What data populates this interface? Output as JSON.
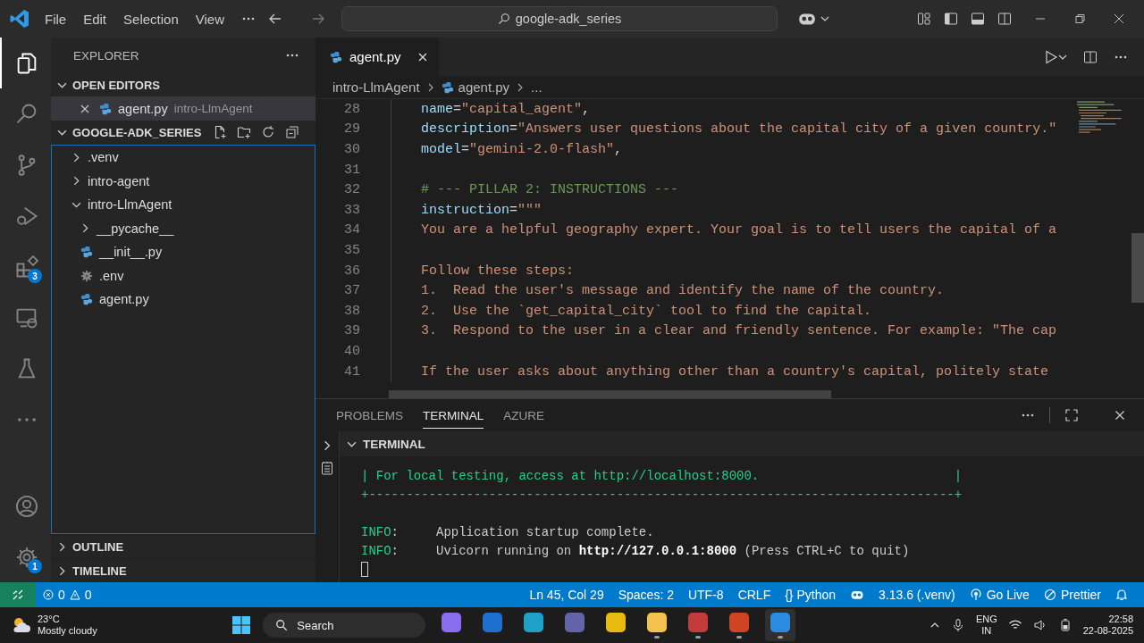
{
  "title_bar": {
    "menu": [
      "File",
      "Edit",
      "Selection",
      "View"
    ],
    "search": "google-adk_series"
  },
  "activity_bar": {
    "top": [
      {
        "kind": "explorer",
        "selected": true
      },
      {
        "kind": "search",
        "selected": false
      },
      {
        "kind": "source-control",
        "selected": false
      },
      {
        "kind": "run-debug",
        "selected": false
      },
      {
        "kind": "extensions",
        "selected": false,
        "badge": "3"
      },
      {
        "kind": "remote",
        "selected": false
      },
      {
        "kind": "testing",
        "selected": false
      },
      {
        "kind": "more",
        "selected": false
      }
    ],
    "bottom": [
      {
        "kind": "accounts",
        "selected": false
      },
      {
        "kind": "manage",
        "selected": false,
        "badge": "1"
      }
    ]
  },
  "sidebar": {
    "title": "EXPLORER",
    "open_editors": {
      "title": "OPEN EDITORS",
      "expanded": true,
      "items": [
        {
          "name": "agent.py",
          "folder": "intro-LlmAgent",
          "kind": "python"
        }
      ]
    },
    "workspace": {
      "title": "GOOGLE-ADK_SERIES",
      "expanded": true,
      "tree": [
        {
          "name": ".venv",
          "kind": "folder",
          "expanded": false
        },
        {
          "name": "intro-agent",
          "kind": "folder",
          "expanded": false
        },
        {
          "name": "intro-LlmAgent",
          "kind": "folder",
          "expanded": true,
          "children": [
            {
              "name": "__pycache__",
              "kind": "folder",
              "expanded": false
            },
            {
              "name": "__init__.py",
              "kind": "python"
            },
            {
              "name": ".env",
              "kind": "settings"
            },
            {
              "name": "agent.py",
              "kind": "python"
            }
          ]
        }
      ]
    },
    "sections": [
      {
        "title": "OUTLINE",
        "expanded": false
      },
      {
        "title": "TIMELINE",
        "expanded": false
      }
    ]
  },
  "editor": {
    "tabs": [
      {
        "label": "agent.py",
        "kind": "python",
        "selected": true
      }
    ],
    "breadcrumb": [
      {
        "text": "intro-LlmAgent",
        "kind": "folder"
      },
      {
        "text": "agent.py",
        "kind": "python"
      },
      {
        "text": "...",
        "kind": "more"
      }
    ],
    "lines": [
      {
        "number": "28",
        "tokens": [
          {
            "kind": "key",
            "text": "name"
          },
          {
            "kind": "plain",
            "text": "="
          },
          {
            "kind": "string",
            "text": "\"capital_agent\""
          },
          {
            "kind": "plain",
            "text": ","
          }
        ]
      },
      {
        "number": "29",
        "tokens": [
          {
            "kind": "key",
            "text": "description"
          },
          {
            "kind": "plain",
            "text": "="
          },
          {
            "kind": "string",
            "text": "\"Answers user questions about the capital city of a given country.\""
          }
        ]
      },
      {
        "number": "30",
        "tokens": [
          {
            "kind": "key",
            "text": "model"
          },
          {
            "kind": "plain",
            "text": "="
          },
          {
            "kind": "string",
            "text": "\"gemini-2.0-flash\""
          },
          {
            "kind": "plain",
            "text": ","
          }
        ]
      },
      {
        "number": "31"
      },
      {
        "number": "32",
        "tokens": [
          {
            "kind": "comment",
            "text": "# --- PILLAR 2: INSTRUCTIONS ---"
          }
        ]
      },
      {
        "number": "33",
        "tokens": [
          {
            "kind": "key",
            "text": "instruction"
          },
          {
            "kind": "plain",
            "text": "="
          },
          {
            "kind": "string",
            "text": "\"\"\""
          }
        ]
      },
      {
        "number": "34",
        "tokens": [
          {
            "kind": "string",
            "text": "You are a helpful geography expert. Your goal is to tell users the capital of a"
          }
        ]
      },
      {
        "number": "35"
      },
      {
        "number": "36",
        "tokens": [
          {
            "kind": "string",
            "text": "Follow these steps:"
          }
        ]
      },
      {
        "number": "37",
        "tokens": [
          {
            "kind": "string",
            "text": "1.  Read the user's message and identify the name of the country."
          }
        ]
      },
      {
        "number": "38",
        "tokens": [
          {
            "kind": "string",
            "text": "2.  Use the `get_capital_city` tool to find the capital."
          }
        ]
      },
      {
        "number": "39",
        "tokens": [
          {
            "kind": "string",
            "text": "3.  Respond to the user in a clear and friendly sentence. For example: \"The cap"
          }
        ]
      },
      {
        "number": "40"
      },
      {
        "number": "41",
        "tokens": [
          {
            "kind": "string",
            "text": "If the user asks about anything other than a country's capital, politely state"
          }
        ]
      }
    ]
  },
  "panel": {
    "tabs": [
      {
        "label": "PROBLEMS",
        "selected": false
      },
      {
        "label": "TERMINAL",
        "selected": true
      },
      {
        "label": "AZURE",
        "selected": false
      }
    ],
    "section": {
      "title": "TERMINAL",
      "expanded": true
    },
    "lines": [
      {
        "tokens": [
          {
            "kind": "green",
            "text": "| For local testing, access at http://localhost:8000.                          |"
          }
        ]
      },
      {
        "tokens": [
          {
            "kind": "green",
            "text": "+------------------------------------------------------------------------------+"
          }
        ]
      },
      {
        "gap_before": true,
        "tokens": [
          {
            "kind": "green",
            "text": "INFO"
          },
          {
            "kind": "plain",
            "text": ":     Application startup complete."
          }
        ]
      },
      {
        "tokens": [
          {
            "kind": "green",
            "text": "INFO"
          },
          {
            "kind": "plain",
            "text": ":     Uvicorn running on "
          },
          {
            "kind": "bold",
            "text": "http://127.0.0.1:8000"
          },
          {
            "kind": "plain",
            "text": " (Press CTRL+C to quit)"
          }
        ]
      }
    ]
  },
  "status_bar": {
    "errors": "0",
    "warnings": "0",
    "items": [
      {
        "kind": "text",
        "text": "Ln 45, Col 29"
      },
      {
        "kind": "text",
        "text": "Spaces: 2"
      },
      {
        "kind": "text",
        "text": "UTF-8"
      },
      {
        "kind": "text",
        "text": "CRLF"
      },
      {
        "kind": "glyph",
        "glyph": "{}",
        "text": "Python"
      },
      {
        "kind": "bot"
      },
      {
        "kind": "text",
        "text": "3.13.6 (.venv)"
      },
      {
        "kind": "broadcast",
        "text": "Go Live"
      },
      {
        "kind": "circle-slash",
        "text": "Prettier"
      },
      {
        "kind": "bell"
      }
    ]
  },
  "taskbar": {
    "weather": {
      "temperature": "23°C",
      "condition": "Mostly cloudy"
    },
    "search": "Search",
    "apps": [
      {
        "kind": "copilot",
        "running": false,
        "selected": false
      },
      {
        "kind": "outlook",
        "running": false,
        "selected": false
      },
      {
        "kind": "edge",
        "running": false,
        "selected": false
      },
      {
        "kind": "teams",
        "running": false,
        "selected": false
      },
      {
        "kind": "chrome",
        "running": false,
        "selected": false
      },
      {
        "kind": "files",
        "running": true,
        "selected": false
      },
      {
        "kind": "recorder",
        "running": true,
        "selected": false
      },
      {
        "kind": "powerpoint",
        "running": true,
        "selected": false
      },
      {
        "kind": "vscode",
        "running": true,
        "selected": true
      }
    ],
    "language": "ENG",
    "region": "IN",
    "time": "22:58",
    "date": "22-08-2025"
  }
}
